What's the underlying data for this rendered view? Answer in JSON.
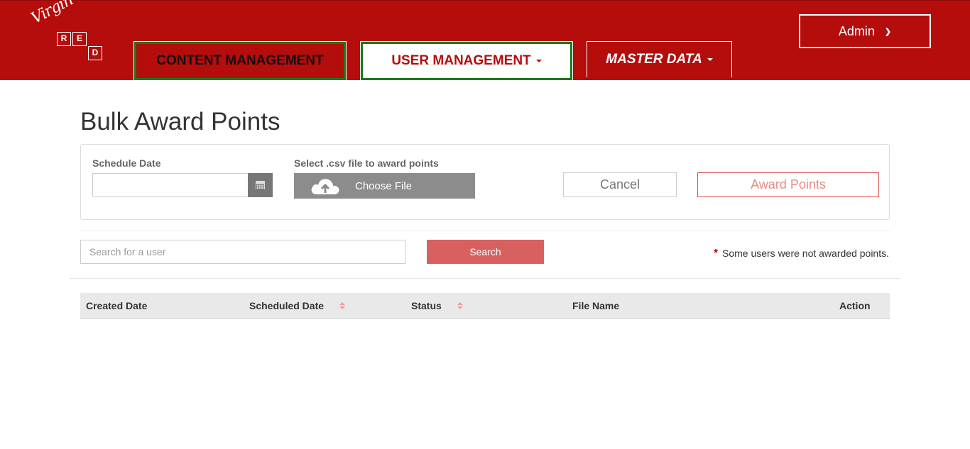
{
  "logo": {
    "script": "Virgin",
    "letters": [
      "R",
      "E",
      "D"
    ]
  },
  "nav": {
    "content_management": "CONTENT MANAGEMENT",
    "user_management": "USER MANAGEMENT",
    "master_data": "MASTER DATA",
    "admin": "Admin"
  },
  "page": {
    "title": "Bulk Award Points"
  },
  "form": {
    "schedule_date_label": "Schedule Date",
    "schedule_date_value": "",
    "csv_label": "Select .csv file to award points",
    "choose_file": "Choose File",
    "cancel": "Cancel",
    "award_points": "Award Points"
  },
  "search": {
    "placeholder": "Search for a user",
    "button": "Search",
    "note_star": "*",
    "note": "Some users were not awarded points."
  },
  "table": {
    "columns": [
      "Created Date",
      "Scheduled Date",
      "Status",
      "File Name",
      "Action"
    ],
    "rows": []
  },
  "colors": {
    "brand_red": "#b50c0c",
    "active_outline": "#1a7a1a",
    "search_button": "#d96060"
  },
  "icons": [
    "calendar-icon",
    "cloud-upload-icon",
    "chevron-down-icon",
    "sort-icon",
    "caret-down-icon"
  ]
}
